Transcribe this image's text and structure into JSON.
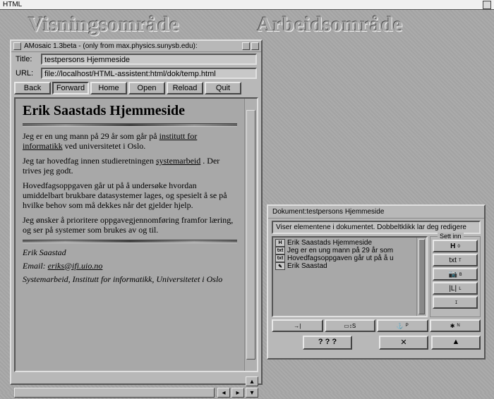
{
  "app_title": "HTML",
  "sections": {
    "left": "Visningsområde",
    "right": "Arbeidsområde"
  },
  "browser": {
    "window_title": "AMosaic 1.3beta - (only from max.physics.sunysb.edu):",
    "title_label": "Title:",
    "title_value": "testpersons Hjemmeside",
    "url_label": "URL:",
    "url_value": "file://localhost/HTML-assistent:html/dok/temp.html",
    "buttons": {
      "back": "Back",
      "forward": "Forward",
      "home": "Home",
      "open": "Open",
      "reload": "Reload",
      "quit": "Quit"
    },
    "page": {
      "heading": "Erik Saastads Hjemmeside",
      "p1_a": "Jeg er en ung mann på 29 år som går på ",
      "p1_link1": "institutt for informatikk",
      "p1_b": " ved universitetet i Oslo.",
      "p2_a": "Jeg tar hovedfag innen studieretningen ",
      "p2_link": "systemarbeid",
      "p2_b": " . Der trives jeg godt.",
      "p3": "Hovedfagsoppgaven går ut på å undersøke hvordan umiddelbart brukbare datasystemer lages, og spesielt å se på hvilke behov som må dekkes når det gjelder hjelp.",
      "p4": "Jeg ønsker å prioritere oppgavegjennomføring framfor læring, og ser på systemer som brukes av og til.",
      "sig_name": "Erik Saastad",
      "sig_email_label": "Email: ",
      "sig_email": "eriks@ifi.uio.no",
      "sig_affil": "Systemarbeid, Institutt for informatikk, Universitetet i Oslo"
    }
  },
  "work": {
    "doc_label_prefix": "Dokument:",
    "doc_name": "testpersons Hjemmeside",
    "hint": "Viser elementene i dokumentet. Dobbeltklikk lar deg redigere",
    "fieldset_label": "Sett inn",
    "tree": [
      {
        "icon": "H",
        "text": "Erik Saastads Hjemmeside"
      },
      {
        "icon": "txt",
        "text": "Jeg er en ung mann på 29 år som"
      },
      {
        "icon": "txt",
        "text": "Hovedfagsoppgaven går ut på å u"
      },
      {
        "icon": "sig",
        "text": "Erik Saastad"
      }
    ],
    "insert_buttons": [
      {
        "main": "H",
        "sub": "O"
      },
      {
        "main": "txt",
        "sub": "T"
      },
      {
        "main": "📷",
        "sub": "B"
      },
      {
        "main": "|L|",
        "sub": "L"
      },
      {
        "main": "",
        "sub": "I"
      }
    ],
    "bottom_help": "? ? ?",
    "bottom_cancel": "✕",
    "bottom_apply": "▲"
  }
}
